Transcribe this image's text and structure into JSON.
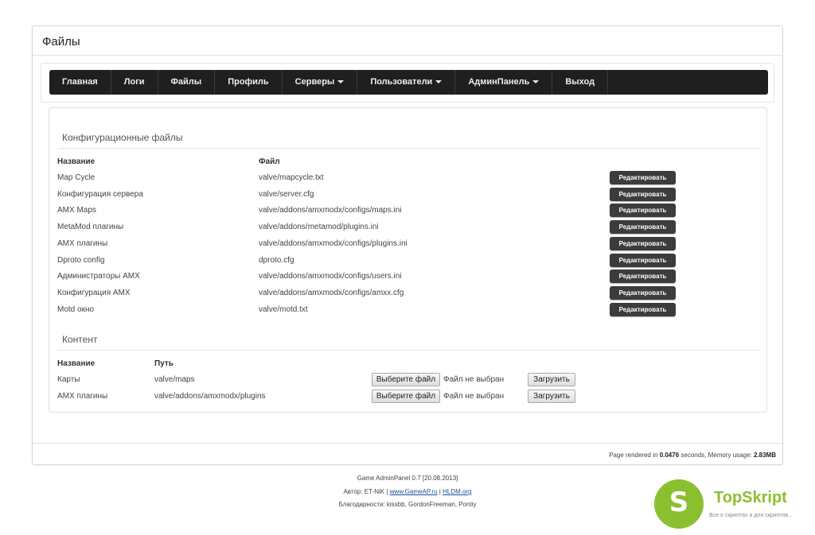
{
  "page": {
    "title": "Файлы"
  },
  "nav": {
    "items": [
      {
        "label": "Главная",
        "dropdown": false
      },
      {
        "label": "Логи",
        "dropdown": false
      },
      {
        "label": "Файлы",
        "dropdown": false
      },
      {
        "label": "Профиль",
        "dropdown": false
      },
      {
        "label": "Серверы",
        "dropdown": true
      },
      {
        "label": "Пользователи",
        "dropdown": true
      },
      {
        "label": "АдминПанель",
        "dropdown": true
      },
      {
        "label": "Выход",
        "dropdown": false
      }
    ]
  },
  "config_files": {
    "title": "Конфигурационные файлы",
    "headers": {
      "name": "Название",
      "file": "Файл"
    },
    "rows": [
      {
        "name": "Map Cycle",
        "file": "valve/mapcycle.txt",
        "action": "Редактировать"
      },
      {
        "name": "Конфигурация сервера",
        "file": "valve/server.cfg",
        "action": "Редактировать"
      },
      {
        "name": "AMX Maps",
        "file": "valve/addons/amxmodx/configs/maps.ini",
        "action": "Редактировать"
      },
      {
        "name": "MetaMod плагины",
        "file": "valve/addons/metamod/plugins.ini",
        "action": "Редактировать"
      },
      {
        "name": "AMX плагины",
        "file": "valve/addons/amxmodx/configs/plugins.ini",
        "action": "Редактировать"
      },
      {
        "name": "Dproto config",
        "file": "dproto.cfg",
        "action": "Редактировать"
      },
      {
        "name": "Администраторы AMX",
        "file": "valve/addons/amxmodx/configs/users.ini",
        "action": "Редактировать"
      },
      {
        "name": "Конфигурация AMX",
        "file": "valve/addons/amxmodx/configs/amxx.cfg",
        "action": "Редактировать"
      },
      {
        "name": "Motd окно",
        "file": "valve/motd.txt",
        "action": "Редактировать"
      }
    ]
  },
  "content_section": {
    "title": "Контент",
    "headers": {
      "name": "Название",
      "path": "Путь"
    },
    "rows": [
      {
        "name": "Карты",
        "path": "valve/maps",
        "choose": "Выберите файл",
        "status": "Файл не выбран",
        "upload": "Загрузить"
      },
      {
        "name": "AMX плагины",
        "path": "valve/addons/amxmodx/plugins",
        "choose": "Выберите файл",
        "status": "Файл не выбран",
        "upload": "Загрузить"
      }
    ]
  },
  "render_info": {
    "prefix": "Page rendered in ",
    "seconds": "0.0476",
    "middle": " seconds, Memory usage: ",
    "memory": "2.83MB"
  },
  "credits": {
    "line1": "Game AdminPanel 0.7 [20.08.2013]",
    "author_prefix": "Автор: ET-NiK | ",
    "link1": "www.GameAP.ru",
    "sep": " | ",
    "link2": "HLDM.org",
    "line3": "Благодарности: kissbb, GordonFreeman, Pontiy"
  },
  "brand": {
    "letter": "S",
    "name": "TopSkript",
    "tagline": "Все о скриптах и для скриптов...",
    "color": "#8cbf2f"
  }
}
